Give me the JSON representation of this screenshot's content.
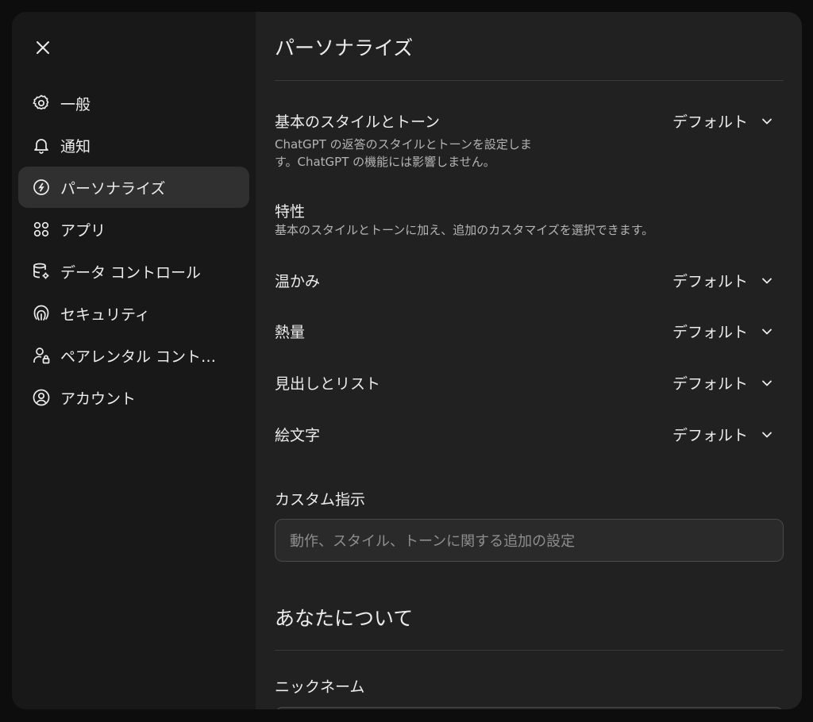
{
  "sidebar": {
    "close_icon": "close-icon",
    "items": [
      {
        "label": "一般",
        "icon": "gear-icon",
        "active": false
      },
      {
        "label": "通知",
        "icon": "bell-icon",
        "active": false
      },
      {
        "label": "パーソナライズ",
        "icon": "personalize-icon",
        "active": true
      },
      {
        "label": "アプリ",
        "icon": "apps-grid-icon",
        "active": false
      },
      {
        "label": "データ コントロール",
        "icon": "database-gear-icon",
        "active": false
      },
      {
        "label": "セキュリティ",
        "icon": "fingerprint-icon",
        "active": false
      },
      {
        "label": "ペアレンタル コント…",
        "icon": "parent-lock-icon",
        "active": false
      },
      {
        "label": "アカウント",
        "icon": "account-circle-icon",
        "active": false
      }
    ]
  },
  "main": {
    "title": "パーソナライズ",
    "base_style": {
      "label": "基本のスタイルとトーン",
      "description_line1": "ChatGPT の返答のスタイルとトーンを設定しま",
      "description_line2": "す。ChatGPT の機能には影響しません。",
      "value": "デフォルト"
    },
    "traits": {
      "label": "特性",
      "description": "基本のスタイルとトーンに加え、追加のカスタマイズを選択できます。",
      "items": [
        {
          "label": "温かみ",
          "value": "デフォルト"
        },
        {
          "label": "熱量",
          "value": "デフォルト"
        },
        {
          "label": "見出しとリスト",
          "value": "デフォルト"
        },
        {
          "label": "絵文字",
          "value": "デフォルト"
        }
      ]
    },
    "custom_instructions": {
      "label": "カスタム指示",
      "placeholder": "動作、スタイル、トーンに関する追加の設定"
    },
    "about_you": {
      "title": "あなたについて",
      "nickname_label": "ニックネーム"
    }
  }
}
